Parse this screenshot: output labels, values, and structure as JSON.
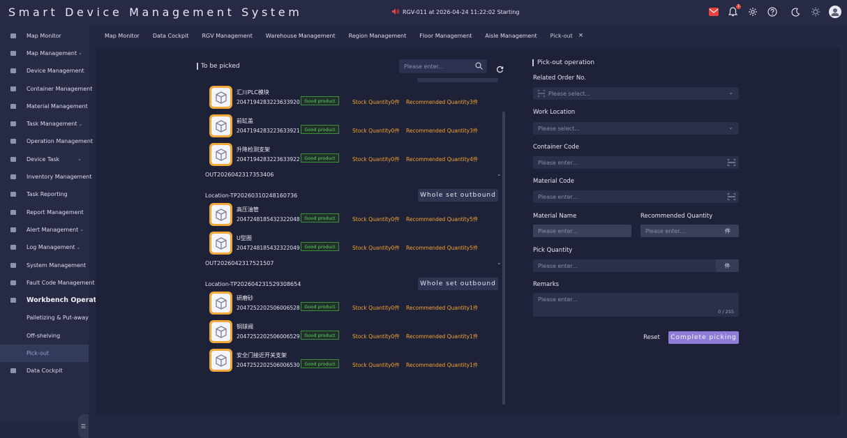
{
  "app": {
    "title": "Smart Device Management System"
  },
  "header": {
    "status_text": "RGV-011 at 2026-04-24 11:22:02 Starting",
    "notification_count": "1",
    "icons": [
      "mail-icon",
      "bell-icon",
      "gear-icon",
      "help-icon",
      "moon-icon",
      "sun-icon",
      "avatar"
    ]
  },
  "sidebar": {
    "items": [
      {
        "label": "Map Monitor",
        "icon": "map-icon",
        "chevron": false
      },
      {
        "label": "Map Management",
        "icon": "map-icon",
        "chevron": true
      },
      {
        "label": "Device Management",
        "icon": "device-icon",
        "chevron": false
      },
      {
        "label": "Container Management",
        "icon": "container-icon",
        "chevron": false
      },
      {
        "label": "Material Management",
        "icon": "material-icon",
        "chevron": false
      },
      {
        "label": "Task Management",
        "icon": "task-icon",
        "chevron": true
      },
      {
        "label": "Operation Management",
        "icon": "operation-icon",
        "chevron": false
      },
      {
        "label": "Device Task",
        "icon": "device-task-icon",
        "chevron": true
      },
      {
        "label": "Inventory Management",
        "icon": "inventory-icon",
        "chevron": false
      },
      {
        "label": "Task Reporting",
        "icon": "report-icon",
        "chevron": false
      },
      {
        "label": "Report Management",
        "icon": "report-icon",
        "chevron": false
      },
      {
        "label": "Alert Management",
        "icon": "alert-icon",
        "chevron": true
      },
      {
        "label": "Log Management",
        "icon": "log-icon",
        "chevron": true
      },
      {
        "label": "System Management",
        "icon": "system-icon",
        "chevron": false
      },
      {
        "label": "Fault Code Management",
        "icon": "fault-icon",
        "chevron": false
      },
      {
        "label": "Workbench Operation",
        "icon": "workbench-icon",
        "chevron": false,
        "bold": true
      },
      {
        "label": "Palletizing & Put-away",
        "sub": true
      },
      {
        "label": "Off-shelving",
        "sub": true
      },
      {
        "label": "Pick-out",
        "sub": true,
        "active": true
      },
      {
        "label": "Data Cockpit",
        "icon": "cockpit-icon",
        "chevron": false
      }
    ]
  },
  "tabs": [
    "Map Monitor",
    "Data Cockpit",
    "RGV Management",
    "Warehouse Management",
    "Region Management",
    "Floor Management",
    "Aisle Management",
    "Pick-out"
  ],
  "left": {
    "title": "To be picked",
    "search_placeholder": "Please enter...",
    "groups": [
      {
        "order": "",
        "location": "",
        "button": "",
        "products": [
          {
            "name": "汇川PLC模块",
            "code": "2047194283223633920",
            "status": "Good product",
            "stock": "Stock Quantity0件",
            "recommended": "Recommended Quantity3件"
          },
          {
            "name": "前缸盖",
            "code": "2047194283223633921",
            "status": "Good product",
            "stock": "Stock Quantity0件",
            "recommended": "Recommended Quantity3件"
          },
          {
            "name": "升降检测支架",
            "code": "2047194283223633922",
            "status": "Good product",
            "stock": "Stock Quantity0件",
            "recommended": "Recommended Quantity4件"
          }
        ]
      },
      {
        "order": "OUT2026042317353406",
        "location": "Location-TP202603102481607​36",
        "button": "Whole set outbound",
        "products": [
          {
            "name": "高压油管",
            "code": "2047248185432322048",
            "status": "Good product",
            "stock": "Stock Quantity0件",
            "recommended": "Recommended Quantity5件"
          },
          {
            "name": "U型圈",
            "code": "2047248185432322049",
            "status": "Good product",
            "stock": "Stock Quantity0件",
            "recommended": "Recommended Quantity5件"
          }
        ]
      },
      {
        "order": "OUT2026042317521507",
        "location": "Location-TP202604231529308654",
        "button": "Whole set outbound",
        "products": [
          {
            "name": "研磨砂",
            "code": "2047252202506006528",
            "status": "Good product",
            "stock": "Stock Quantity0件",
            "recommended": "Recommended Quantity1件"
          },
          {
            "name": "铜球阀",
            "code": "2047252202506006529",
            "status": "Good product",
            "stock": "Stock Quantity0件",
            "recommended": "Recommended Quantity1件"
          },
          {
            "name": "安全门接近开关支架",
            "code": "2047252202506006530",
            "status": "Good product",
            "stock": "Stock Quantity0件",
            "recommended": "Recommended Quantity1件"
          }
        ]
      }
    ]
  },
  "right": {
    "title": "Pick-out operation",
    "related_order_label": "Related Order No.",
    "related_order_placeholder": "Please select...",
    "work_location_label": "Work Location",
    "work_location_placeholder": "Please select...",
    "container_code_label": "Container Code",
    "container_code_placeholder": "Please enter...",
    "material_code_label": "Material Code",
    "material_code_placeholder": "Please enter...",
    "material_name_label": "Material Name",
    "material_name_placeholder": "Please enter...",
    "recommended_qty_label": "Recommended Quantity",
    "recommended_qty_placeholder": "Please enter...",
    "recommended_qty_unit": "件",
    "pick_qty_label": "Pick Quantity",
    "pick_qty_placeholder": "Please enter...",
    "pick_qty_unit": "件",
    "remarks_label": "Remarks",
    "remarks_placeholder": "Please enter...",
    "remarks_counter": "0 / 255",
    "reset_label": "Reset",
    "complete_label": "Complete picking"
  },
  "colors": {
    "accent": "#8e7ed8",
    "warning": "#f4a230",
    "success": "#5ed066",
    "box": "#f0a93a"
  }
}
